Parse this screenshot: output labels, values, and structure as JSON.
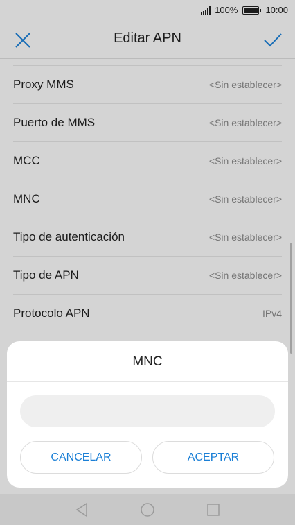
{
  "status_bar": {
    "battery": "100%",
    "time": "10:00"
  },
  "app_bar": {
    "title": "Editar APN"
  },
  "list": {
    "items": [
      {
        "label": "Proxy MMS",
        "value": "<Sin establecer>"
      },
      {
        "label": "Puerto de MMS",
        "value": "<Sin establecer>"
      },
      {
        "label": "MCC",
        "value": "<Sin establecer>"
      },
      {
        "label": "MNC",
        "value": "<Sin establecer>"
      },
      {
        "label": "Tipo de autenticación",
        "value": "<Sin establecer>"
      },
      {
        "label": "Tipo de APN",
        "value": "<Sin establecer>"
      },
      {
        "label": "Protocolo APN",
        "value": "IPv4"
      }
    ]
  },
  "dialog": {
    "title": "MNC",
    "input_value": "",
    "cancel_label": "CANCELAR",
    "ok_label": "ACEPTAR"
  },
  "colors": {
    "accent": "#1a7fd6"
  },
  "icons": {
    "close": "close-icon",
    "confirm": "check-icon",
    "back": "back-triangle-icon",
    "home": "home-circle-icon",
    "recents": "recents-square-icon"
  }
}
